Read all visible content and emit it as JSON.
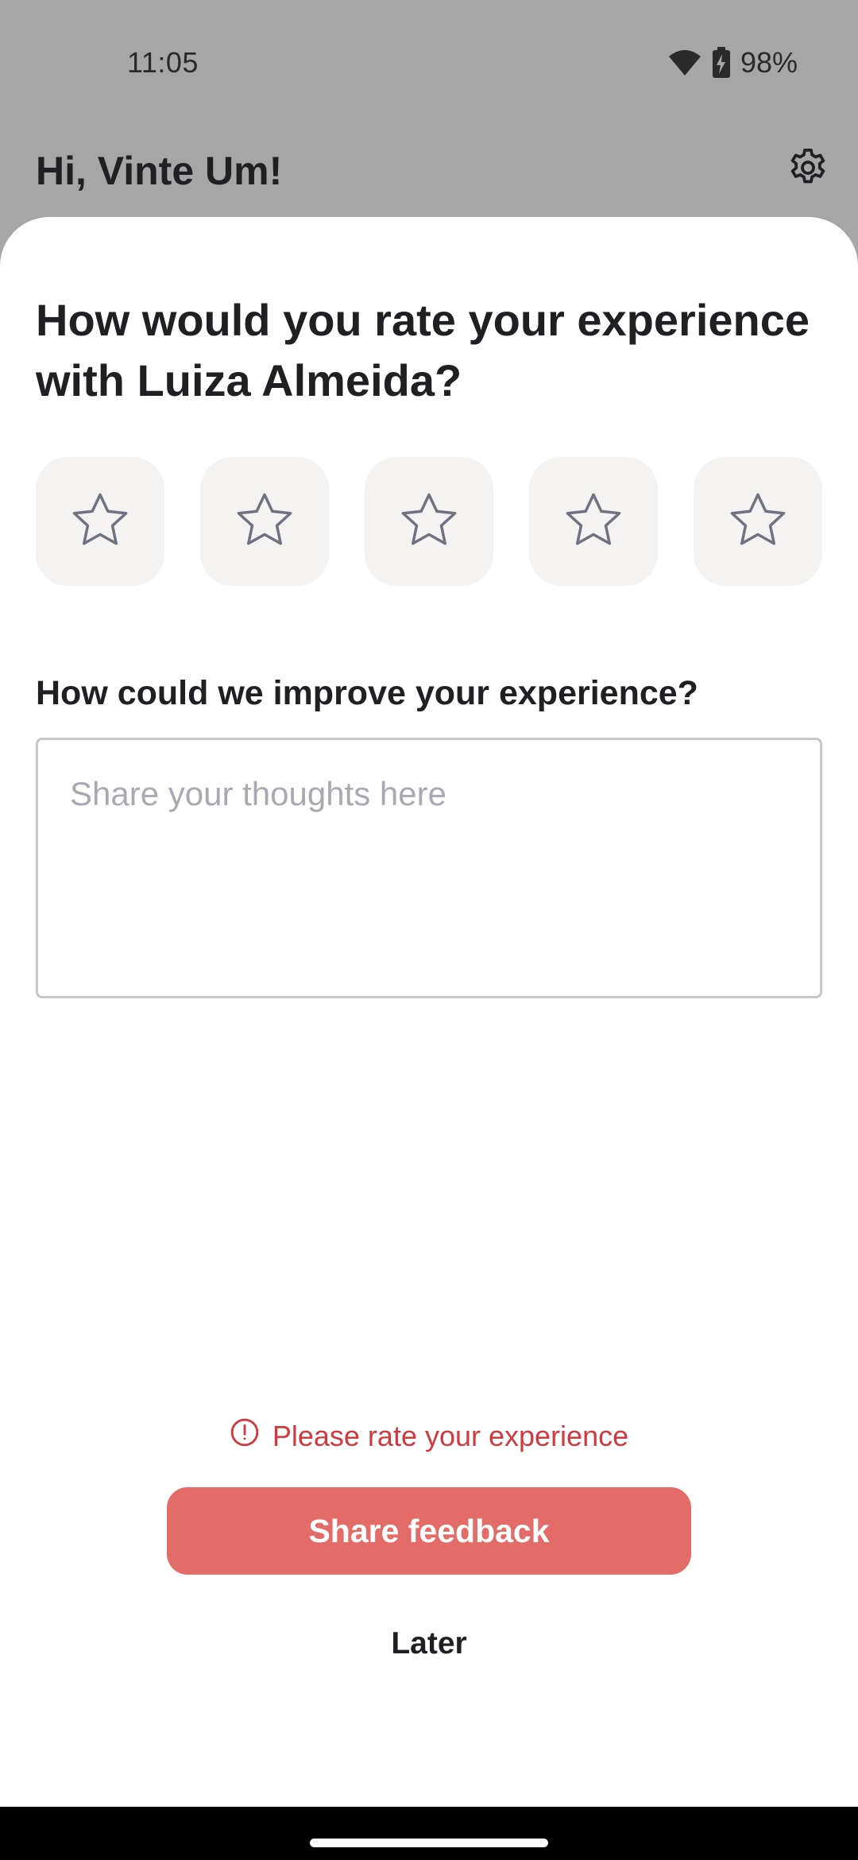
{
  "status_bar": {
    "time": "11:05",
    "battery": "98%",
    "icons": [
      "wifi-icon",
      "battery-charging-icon"
    ]
  },
  "header": {
    "greeting": "Hi, Vinte Um!",
    "settings_icon": "gear-icon"
  },
  "sheet": {
    "title": "How would you rate your experience with Luiza Almeida?",
    "rating": {
      "max_stars": 5,
      "selected": 0,
      "star_icon": "star-outline-icon"
    },
    "improve_question": "How could we improve your experience?",
    "thoughts_input": {
      "value": "",
      "placeholder": "Share your thoughts here"
    },
    "error_message": "Please rate your experience",
    "share_button": "Share feedback",
    "later_button": "Later"
  },
  "colors": {
    "accent_button": "#e36b68",
    "error": "#cf3a3f",
    "star_tile": "#f4f3f2",
    "scrim": "#a6a6a6"
  }
}
